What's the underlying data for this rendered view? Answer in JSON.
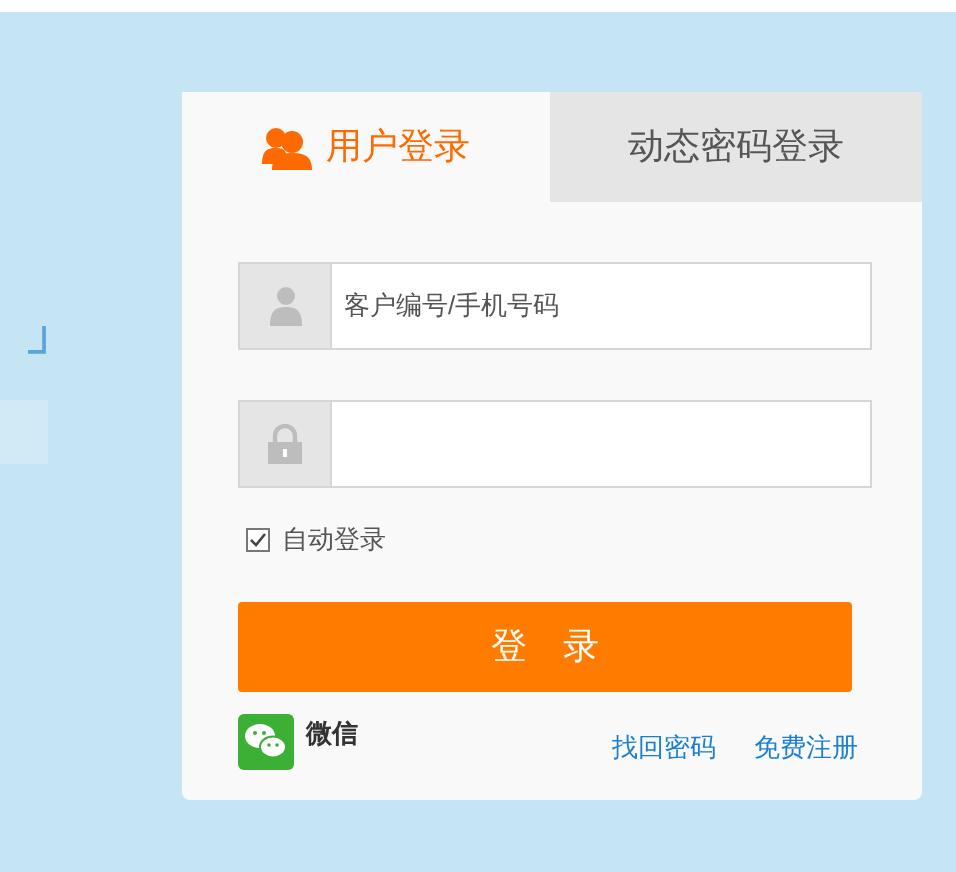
{
  "banner": {
    "bracket": "」"
  },
  "tabs": [
    {
      "label": "用户登录",
      "selected": true
    },
    {
      "label": "动态密码登录",
      "selected": false
    }
  ],
  "username": {
    "placeholder": "客户编号/手机号码"
  },
  "auto_login": {
    "label": "自动登录",
    "checked": true
  },
  "login_button": "登　录",
  "wechat": {
    "label": "微信"
  },
  "links": [
    "找回密码",
    "免费注册"
  ]
}
